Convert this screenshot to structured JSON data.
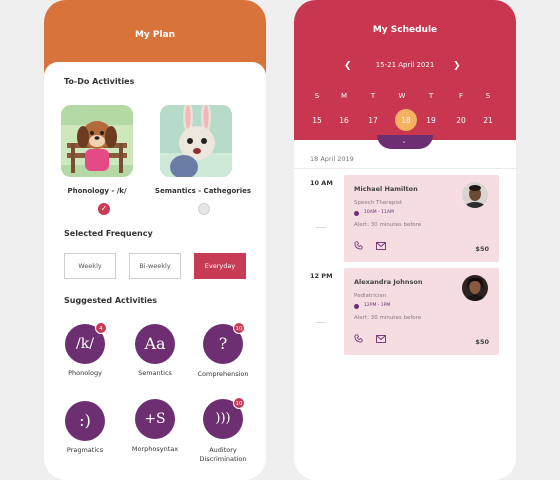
{
  "plan": {
    "title": "My Plan",
    "todo_title": "To-Do Activities",
    "todo": [
      {
        "label": "Phonology - /k/",
        "checked": true
      },
      {
        "label": "Semantics - Cathegories",
        "checked": false
      }
    ],
    "frequency_title": "Selected Frequency",
    "frequency": [
      "Weekly",
      "Bi-weekly",
      "Everyday"
    ],
    "frequency_selected": "Everyday",
    "suggested_title": "Suggested Activities",
    "activities": [
      {
        "symbol": "/k/",
        "label": "Phonology",
        "badge": "4"
      },
      {
        "symbol": "Aa",
        "label": "Semantics",
        "badge": ""
      },
      {
        "symbol": "?",
        "label": "Comprehension",
        "badge": "10"
      },
      {
        "symbol": ":)",
        "label": "Pragmatics",
        "badge": ""
      },
      {
        "symbol": "+S",
        "label": "Morphosyntax",
        "badge": ""
      },
      {
        "symbol": ")))",
        "label": "Auditory",
        "label2": "Discrimination",
        "badge": "10"
      }
    ],
    "colors": {
      "header": "#d8743b",
      "accent": "#c73b55",
      "activity": "#6e2f72"
    }
  },
  "schedule": {
    "title": "My Schedule",
    "range": "15-21 April 2021",
    "weekdays": [
      "S",
      "M",
      "T",
      "W",
      "T",
      "F",
      "S"
    ],
    "days": [
      "15",
      "16",
      "17",
      "18",
      "19",
      "20",
      "21"
    ],
    "selected_day": "18",
    "date_label": "18 April 2019",
    "events": [
      {
        "time": "10 AM",
        "name": "Michael Hamilton",
        "role": "Speech Therapist",
        "slot": "10AM - 11AM",
        "alert": "Alert: 30 minutes before",
        "price": "$50"
      },
      {
        "time": "12 PM",
        "name": "Alexandra Johnson",
        "role": "Pediatrician",
        "slot": "12PM - 1PM",
        "alert": "Alert: 30 minutes before",
        "price": "$50"
      }
    ],
    "colors": {
      "header": "#c8364f",
      "selected": "#f4b15f",
      "card": "#f5dde2"
    }
  }
}
